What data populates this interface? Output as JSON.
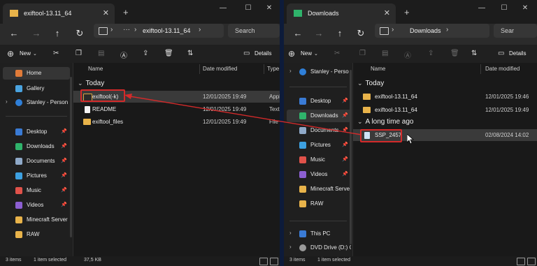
{
  "left": {
    "tab_title": "exiftool-13.11_64",
    "new_tab": "+",
    "address_path": "exiftool-13.11_64",
    "search_placeholder": "Search",
    "new_label": "New",
    "details_label": "Details",
    "sidebar": {
      "top": [
        {
          "label": "Home",
          "icon": "home-icon",
          "color": "#e07b39"
        },
        {
          "label": "Gallery",
          "icon": "gallery-icon",
          "color": "#4aa3df"
        },
        {
          "label": "Stanley - Person",
          "icon": "onedrive-icon",
          "color": "#2f7fd8"
        }
      ],
      "pinned": [
        {
          "label": "Desktop",
          "icon": "desktop-icon",
          "color": "#3a7bd5"
        },
        {
          "label": "Downloads",
          "icon": "downloads-icon",
          "color": "#2fb36b"
        },
        {
          "label": "Documents",
          "icon": "documents-icon",
          "color": "#8fa9c8"
        },
        {
          "label": "Pictures",
          "icon": "pictures-icon",
          "color": "#3da0e0"
        },
        {
          "label": "Music",
          "icon": "music-icon",
          "color": "#e0524a"
        },
        {
          "label": "Videos",
          "icon": "videos-icon",
          "color": "#8c5fd1"
        },
        {
          "label": "Minecraft Server",
          "icon": "folder-icon",
          "color": "#e8b34a"
        },
        {
          "label": "RAW",
          "icon": "folder-icon",
          "color": "#e8b34a"
        }
      ]
    },
    "columns": {
      "name": "Name",
      "date": "Date modified",
      "type": "Type"
    },
    "group_today": "Today",
    "files": [
      {
        "name": "exiftool(-k)",
        "date": "12/01/2025 19:49",
        "type": "Appl",
        "kind": "exe"
      },
      {
        "name": "README",
        "date": "12/01/2025 19:49",
        "type": "Text",
        "kind": "file"
      },
      {
        "name": "exiftool_files",
        "date": "12/01/2025 19:49",
        "type": "File f",
        "kind": "folder"
      }
    ],
    "status": {
      "items": "3 items",
      "selected": "1 item selected",
      "size": "37,5 KB"
    }
  },
  "right": {
    "tab_title": "Downloads",
    "new_tab": "+",
    "address_path": "Downloads",
    "search_placeholder": "Sear",
    "new_label": "New",
    "details_label": "Details",
    "sidebar": {
      "top": [
        {
          "label": "Stanley - Perso",
          "icon": "onedrive-icon",
          "color": "#2f7fd8"
        }
      ],
      "pinned": [
        {
          "label": "Desktop",
          "icon": "desktop-icon",
          "color": "#3a7bd5"
        },
        {
          "label": "Downloads",
          "icon": "downloads-icon",
          "color": "#2fb36b"
        },
        {
          "label": "Documents",
          "icon": "documents-icon",
          "color": "#8fa9c8"
        },
        {
          "label": "Pictures",
          "icon": "pictures-icon",
          "color": "#3da0e0"
        },
        {
          "label": "Music",
          "icon": "music-icon",
          "color": "#e0524a"
        },
        {
          "label": "Videos",
          "icon": "videos-icon",
          "color": "#8c5fd1"
        },
        {
          "label": "Minecraft Server",
          "icon": "folder-icon",
          "color": "#e8b34a"
        },
        {
          "label": "RAW",
          "icon": "folder-icon",
          "color": "#e8b34a"
        }
      ],
      "bottom": [
        {
          "label": "This PC",
          "icon": "this-pc-icon",
          "color": "#3a7bd5"
        },
        {
          "label": "DVD Drive (D:) C",
          "icon": "dvd-drive-icon",
          "color": "#9a9a9a"
        }
      ]
    },
    "columns": {
      "name": "Name",
      "date": "Date modified"
    },
    "group_today": "Today",
    "group_long_ago": "A long time ago",
    "files_today": [
      {
        "name": "exiftool-13.11_64",
        "date": "12/01/2025 19:46"
      },
      {
        "name": "exiftool-13.11_64",
        "date": "12/01/2025 19:49"
      }
    ],
    "files_old": [
      {
        "name": "SSP_2457",
        "date": "02/08/2024 14:02"
      }
    ],
    "status": {
      "items": "3 items",
      "selected": "1 item selected"
    }
  },
  "colors": {
    "highlight": "#d42a2a",
    "folder": "#e8b34a",
    "window_bg": "#202020",
    "desktop_bg": "#0d1b3a"
  }
}
